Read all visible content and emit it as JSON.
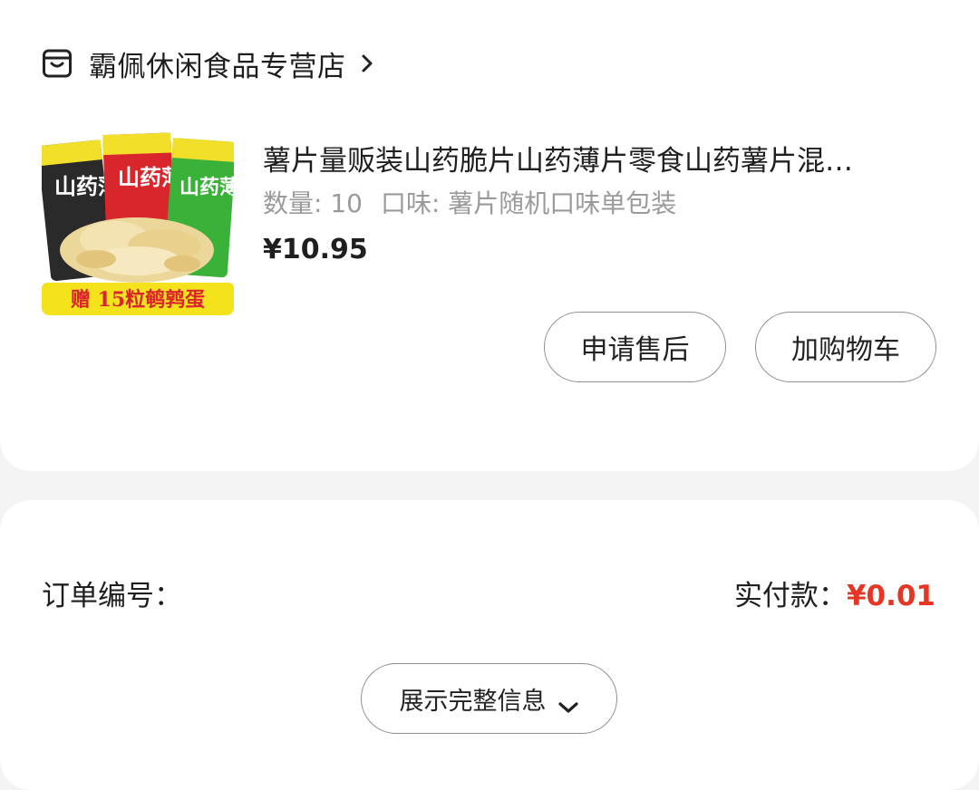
{
  "shop": {
    "name": "霸佩休闲食品专营店",
    "icon": "store-icon"
  },
  "product": {
    "title": "薯片量贩装山药脆片山药薄片零食山药薯片混…",
    "quantity_label": "数量: 10",
    "flavor_label": "口味: 薯片随机口味单包装",
    "price": "¥10.95",
    "image": {
      "pack_texts": [
        "山药薄片",
        "山药薄片",
        "山药薄片"
      ],
      "promo": "赠 15粒鹌鹑蛋",
      "colors": [
        "#2a2a2a",
        "#d9262c",
        "#3ab23a",
        "#f4e21d"
      ]
    }
  },
  "actions": {
    "after_sale": "申请售后",
    "add_to_cart": "加购物车"
  },
  "order": {
    "number_label": "订单编号：",
    "paid_label": "实付款：",
    "paid_value": "¥0.01",
    "expand_label": "展示完整信息",
    "expand_icon": "chevron-down-icon"
  },
  "colors": {
    "accent_red": "#e53525",
    "text_gray": "#9a9a9a",
    "background": "#f4f4f4"
  }
}
